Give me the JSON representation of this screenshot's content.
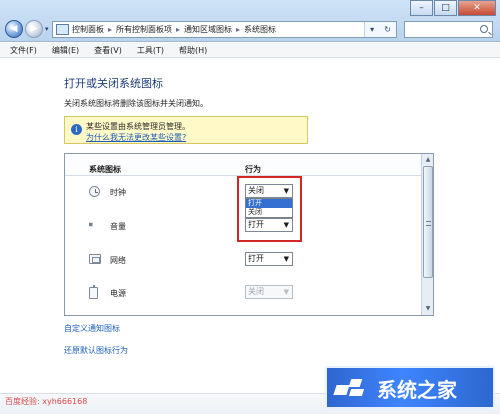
{
  "window": {
    "buttons": {
      "minimize": "–",
      "maximize": "□",
      "close": "✕"
    }
  },
  "navigation": {
    "back": "◀",
    "forward": "▶",
    "dropdown": "▾",
    "breadcrumbs": [
      "控制面板",
      "所有控制面板项",
      "通知区域图标",
      "系统图标"
    ],
    "separator": "▸",
    "address_dropdown": "▾",
    "refresh": "↻"
  },
  "menu": {
    "items": [
      "文件(F)",
      "编辑(E)",
      "查看(V)",
      "工具(T)",
      "帮助(H)"
    ]
  },
  "content": {
    "title": "打开或关闭系统图标",
    "description": "关闭系统图标将删除该图标并关闭通知。",
    "admin_notice": "某些设置由系统管理员管理。",
    "admin_link": "为什么我无法更改某些设置?",
    "table": {
      "headers": {
        "icons": "系统图标",
        "behavior": "行为"
      },
      "rows": [
        {
          "label": "时钟",
          "value": "关闭",
          "icon": "clock-icon",
          "disabled": false
        },
        {
          "label": "音量",
          "value": "打开",
          "icon": "volume-icon",
          "disabled": false
        },
        {
          "label": "网络",
          "value": "打开",
          "icon": "network-icon",
          "disabled": false
        },
        {
          "label": "电源",
          "value": "关闭",
          "icon": "power-icon",
          "disabled": true
        }
      ],
      "dropdown_options": [
        "打开",
        "关闭"
      ]
    },
    "links": {
      "customize": "自定义通知图标",
      "restore": "还原默认图标行为"
    }
  },
  "watermark": {
    "left": "百度经验: xyh666168",
    "logo_text": "系统之家"
  },
  "colors": {
    "highlight": "#d52626",
    "link": "#1c5fb7",
    "selection": "#3470cf"
  }
}
